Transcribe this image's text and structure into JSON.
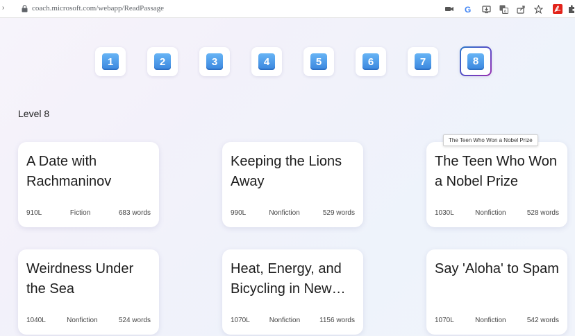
{
  "browser": {
    "url": "coach.microsoft.com/webapp/ReadPassage",
    "extension_icons": [
      "camera-icon",
      "google-icon",
      "install-app-icon",
      "translate-icon",
      "share-icon",
      "star-bookmark-icon",
      "acrobat-icon",
      "extensions-icon"
    ]
  },
  "levels": [
    {
      "label": "1"
    },
    {
      "label": "2"
    },
    {
      "label": "3"
    },
    {
      "label": "4"
    },
    {
      "label": "5"
    },
    {
      "label": "6"
    },
    {
      "label": "7"
    },
    {
      "label": "8"
    }
  ],
  "selected_level": "8",
  "level_heading": "Level 8",
  "tooltip": "The Teen Who Won a Nobel Prize",
  "cards": [
    {
      "title": "A Date with Rachmaninov",
      "lexile": "910L",
      "genre": "Fiction",
      "words": "683 words"
    },
    {
      "title": "Keeping the Lions Away",
      "lexile": "990L",
      "genre": "Nonfiction",
      "words": "529 words"
    },
    {
      "title": "The Teen Who Won a Nobel Prize",
      "lexile": "1030L",
      "genre": "Nonfiction",
      "words": "528 words"
    },
    {
      "title": "Weirdness Under the Sea",
      "lexile": "1040L",
      "genre": "Nonfiction",
      "words": "524 words"
    },
    {
      "title": "Heat, Energy, and Bicycling in New York",
      "lexile": "1070L",
      "genre": "Nonfiction",
      "words": "1156 words"
    },
    {
      "title": "Say 'Aloha' to Spam",
      "lexile": "1070L",
      "genre": "Nonfiction",
      "words": "542 words"
    }
  ],
  "colors": {
    "accent_gradient_start": "#2a77c9",
    "accent_gradient_end": "#9a2fb0",
    "level_badge": "#3a86de"
  }
}
